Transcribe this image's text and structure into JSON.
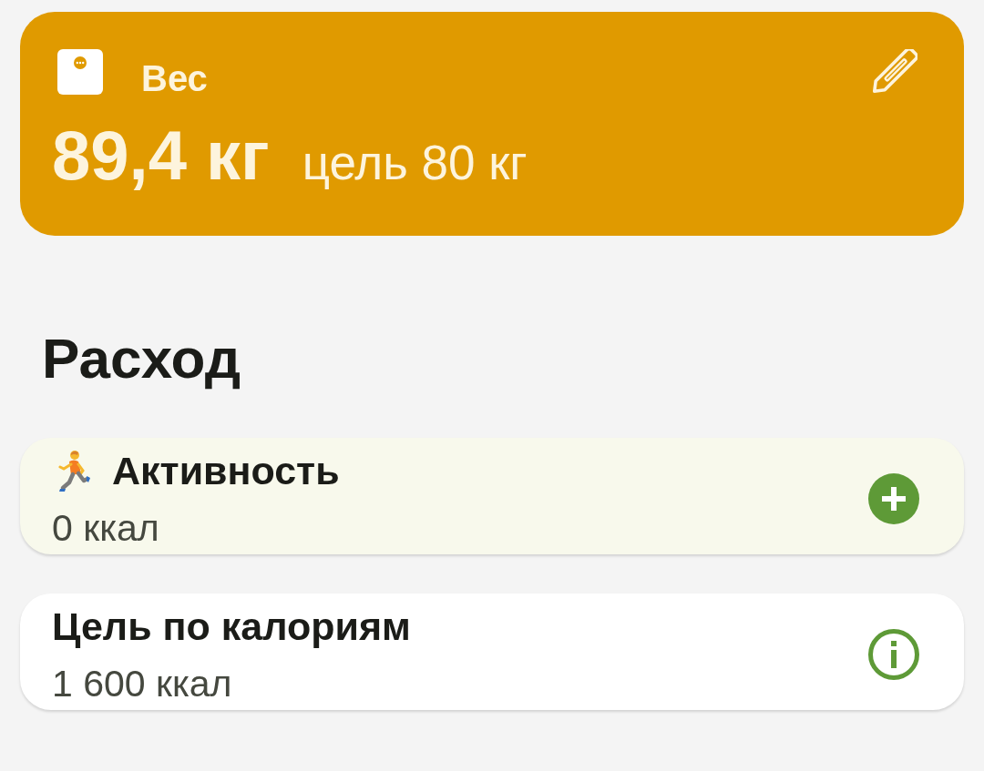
{
  "weight_card": {
    "title": "Вес",
    "value": "89,4 кг",
    "goal": "цель 80 кг"
  },
  "section_title": "Расход",
  "cards": [
    {
      "kind": "activity",
      "title": "Активность",
      "value": "0 ккал"
    },
    {
      "kind": "goal",
      "title": "Цель по калориям",
      "value": "1 600 ккал"
    }
  ]
}
